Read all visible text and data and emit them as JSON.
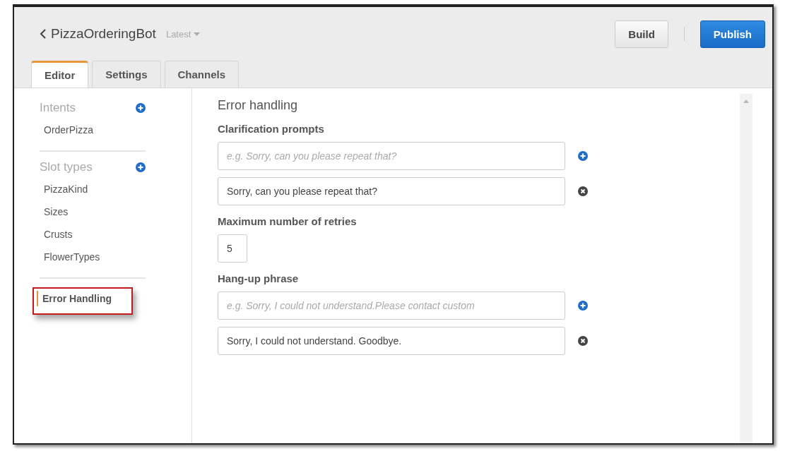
{
  "header": {
    "title": "PizzaOrderingBot",
    "version": "Latest",
    "buttons": [
      {
        "label": "Build",
        "kind": "secondary"
      },
      {
        "label": "Publish",
        "kind": "primary"
      }
    ]
  },
  "tabs": [
    {
      "label": "Editor",
      "selected": true
    },
    {
      "label": "Settings",
      "selected": false
    },
    {
      "label": "Channels",
      "selected": false
    }
  ],
  "sidebar": {
    "sections": [
      {
        "title": "Intents",
        "items": [
          {
            "label": "OrderPizza",
            "selected": false,
            "highlighted": false
          }
        ]
      },
      {
        "title": "Slot types",
        "items": [
          {
            "label": "PizzaKind",
            "selected": false,
            "highlighted": false
          },
          {
            "label": "Sizes",
            "selected": false,
            "highlighted": false
          },
          {
            "label": "Crusts",
            "selected": false,
            "highlighted": false
          },
          {
            "label": "FlowerTypes",
            "selected": false,
            "highlighted": false
          }
        ]
      },
      {
        "items": [
          {
            "label": "Error Handling",
            "selected": true,
            "highlighted": true
          }
        ]
      }
    ]
  },
  "content": {
    "title": "Error handling",
    "groups": [
      {
        "label": "Clarification prompts",
        "fields": [
          {
            "kind": "new",
            "placeholder": "e.g. Sorry, can you please repeat that?"
          },
          {
            "kind": "entry",
            "value": "Sorry, can you please repeat that?"
          }
        ]
      },
      {
        "label": "Maximum number of retries",
        "fields": [
          {
            "kind": "number",
            "value": "5"
          }
        ]
      },
      {
        "label": "Hang-up phrase",
        "fields": [
          {
            "kind": "new",
            "placeholder": "e.g. Sorry, I could not understand.Please contact custom"
          },
          {
            "kind": "entry",
            "value": "Sorry, I could not understand. Goodbye."
          }
        ]
      }
    ]
  }
}
